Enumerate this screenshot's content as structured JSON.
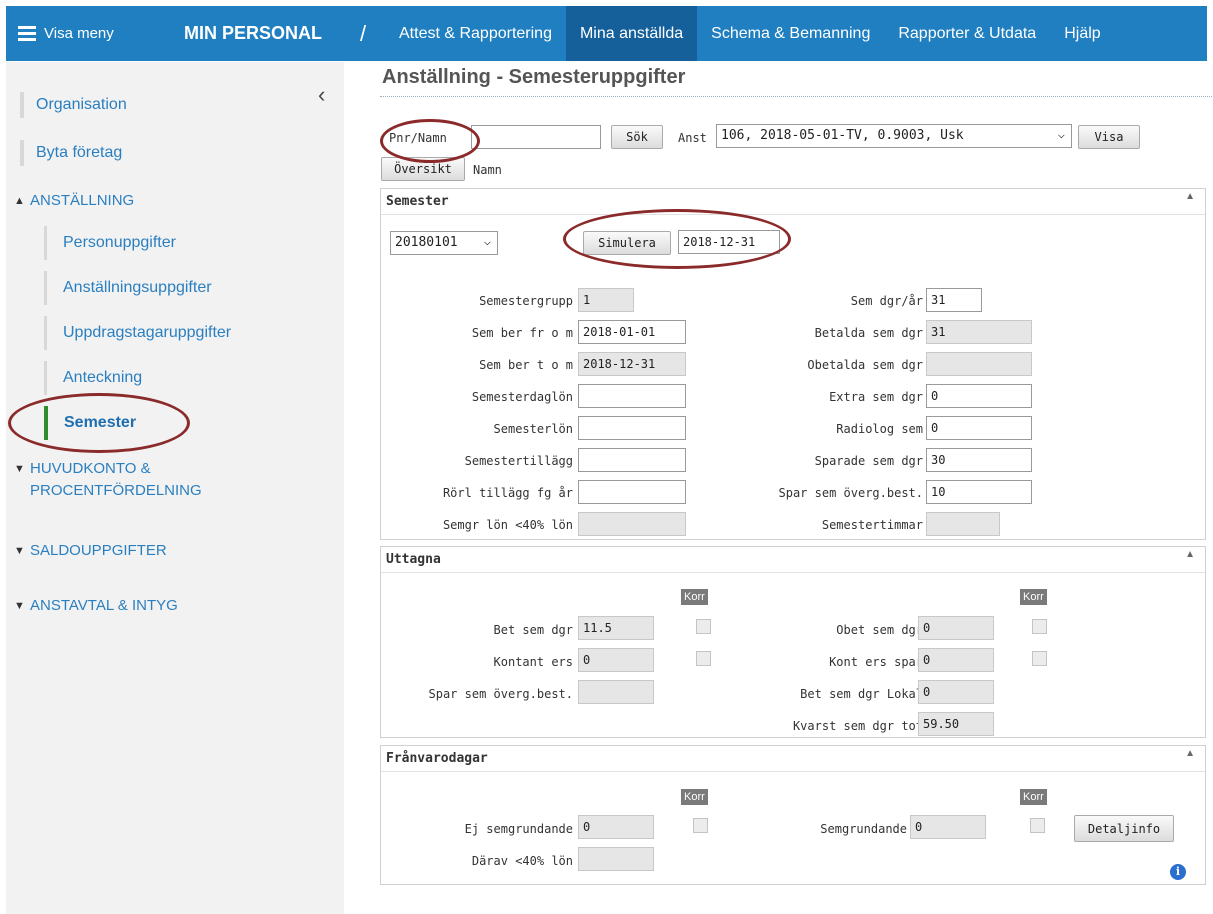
{
  "topbar": {
    "menu_label": "Visa meny",
    "app_title": "MIN PERSONAL",
    "separator": "/",
    "nav": [
      "Attest & Rapportering",
      "Mina anställda",
      "Schema & Bemanning",
      "Rapporter & Utdata",
      "Hjälp"
    ],
    "active_nav": "Mina anställda"
  },
  "sidebar": {
    "links": [
      "Organisation",
      "Byta företag"
    ],
    "sections": [
      {
        "label": "ANSTÄLLNING",
        "expanded": true
      },
      {
        "label": "HUVUDKONTO &\nPROCENTFÖRDELNING",
        "expanded": false
      },
      {
        "label": "SALDOUPPGIFTER",
        "expanded": false
      },
      {
        "label": "ANSTAVTAL & INTYG",
        "expanded": false
      }
    ],
    "items": [
      "Personuppgifter",
      "Anställningsuppgifter",
      "Uppdragstagaruppgifter",
      "Anteckning",
      "Semester"
    ],
    "active_item": "Semester"
  },
  "page": {
    "title": "Anställning - Semesteruppgifter"
  },
  "search": {
    "pnr_label": "Pnr/Namn",
    "pnr_value": "",
    "search_button": "Sök",
    "anst_label": "Anst",
    "anst_value": "106, 2018-05-01-TV, 0.9003, Usk",
    "show_button": "Visa",
    "overview_button": "Översikt",
    "name_label": "Namn"
  },
  "semester": {
    "title": "Semester",
    "year_value": "20180101",
    "simulate_button": "Simulera",
    "simulate_date": "2018-12-31",
    "left_fields": [
      {
        "label": "Semestergrupp",
        "value": "1"
      },
      {
        "label": "Sem ber fr o m",
        "value": "2018-01-01"
      },
      {
        "label": "Sem ber t o m",
        "value": "2018-12-31"
      },
      {
        "label": "Semesterdaglön",
        "value": ""
      },
      {
        "label": "Semesterlön",
        "value": ""
      },
      {
        "label": "Semestertillägg",
        "value": ""
      },
      {
        "label": "Rörl tillägg fg år",
        "value": ""
      },
      {
        "label": "Semgr lön <40% lön",
        "value": ""
      }
    ],
    "right_fields": [
      {
        "label": "Sem dgr/år",
        "value": "31"
      },
      {
        "label": "Betalda sem dgr",
        "value": "31"
      },
      {
        "label": "Obetalda sem dgr",
        "value": ""
      },
      {
        "label": "Extra sem dgr",
        "value": "0"
      },
      {
        "label": "Radiolog sem",
        "value": "0"
      },
      {
        "label": "Sparade sem dgr",
        "value": "30"
      },
      {
        "label": "Spar sem överg.best.",
        "value": "10"
      },
      {
        "label": "Semestertimmar",
        "value": ""
      }
    ]
  },
  "uttagna": {
    "title": "Uttagna",
    "korr_label": "Korr",
    "left_fields": [
      {
        "label": "Bet sem dgr",
        "value": "11.5"
      },
      {
        "label": "Kontant ers",
        "value": "0"
      },
      {
        "label": "Spar sem överg.best.",
        "value": ""
      }
    ],
    "right_fields": [
      {
        "label": "Obet sem dgr",
        "value": "0"
      },
      {
        "label": "Kont ers spar",
        "value": "0"
      },
      {
        "label": "Bet sem dgr Lokal",
        "value": "0"
      },
      {
        "label": "Kvarst sem dgr tot",
        "value": "59.50"
      }
    ]
  },
  "franvaro": {
    "title": "Frånvarodagar",
    "korr_label": "Korr",
    "left_fields": [
      {
        "label": "Ej semgrundande",
        "value": "0"
      },
      {
        "label": "Därav <40% lön",
        "value": ""
      }
    ],
    "right_fields": [
      {
        "label": "Semgrundande",
        "value": "0"
      }
    ],
    "detail_button": "Detaljinfo"
  },
  "info_glyph": "i",
  "colors": {
    "topbar": "#1f7fc0",
    "active_nav": "#15609a",
    "link": "#2a7fc0",
    "highlight_oval": "#8b2a2a"
  }
}
